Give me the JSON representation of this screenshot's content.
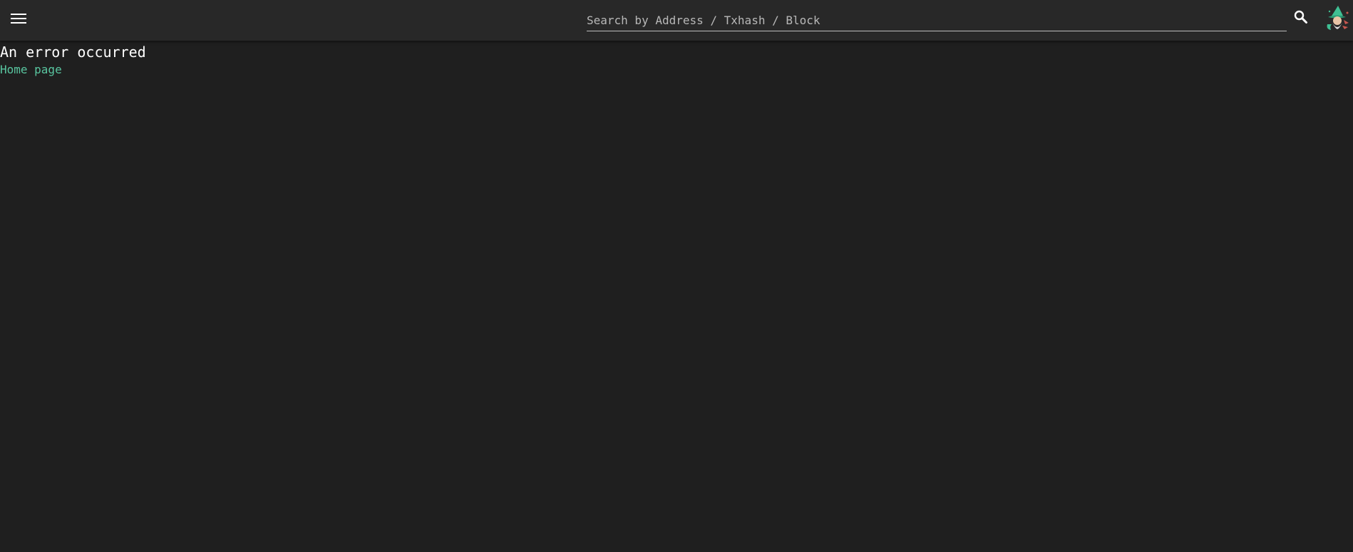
{
  "header": {
    "menu_icon": "hamburger-menu-icon",
    "search": {
      "placeholder": "Search by Address / Txhash / Block",
      "value": ""
    },
    "search_icon": "search-icon",
    "avatar_icon": "wizard-avatar-icon"
  },
  "main": {
    "error_title": "An error occurred",
    "home_link": "Home page"
  },
  "colors": {
    "background": "#1f1f1f",
    "topbar": "#282828",
    "link": "#59c6a0",
    "text": "#ffffff"
  }
}
